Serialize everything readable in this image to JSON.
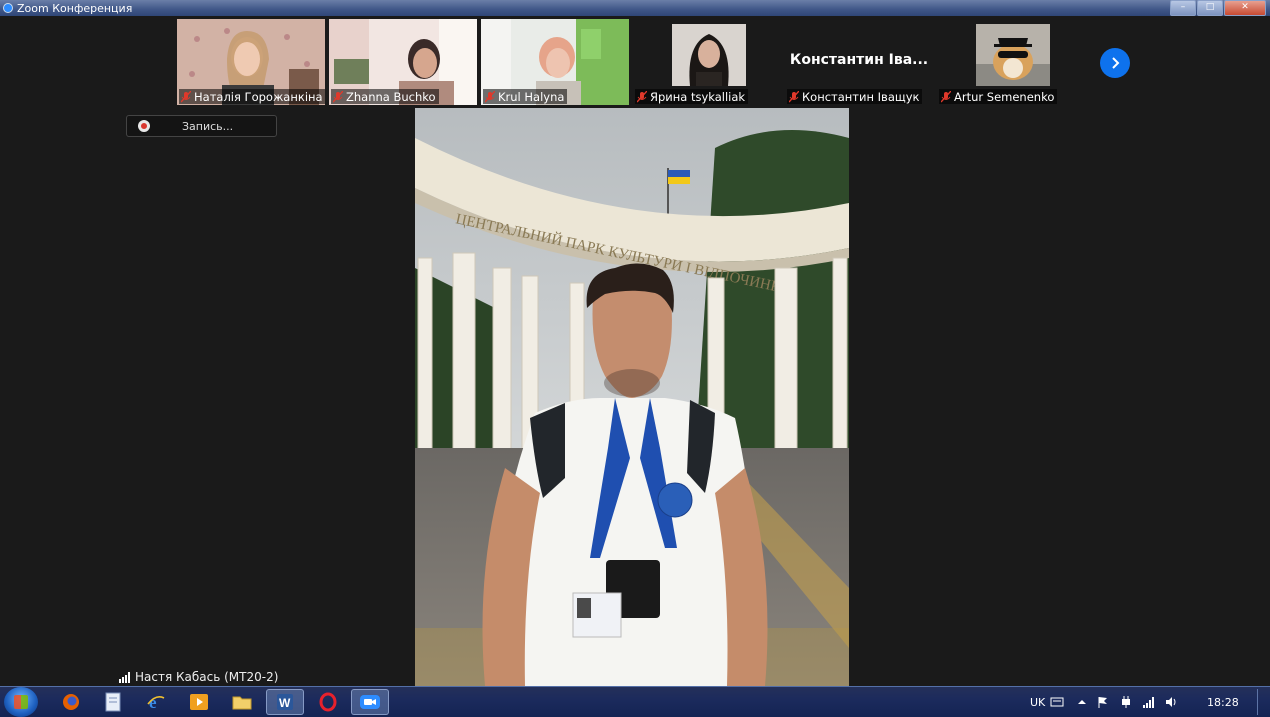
{
  "window": {
    "title": "Zoom Конференция",
    "controls": {
      "minimize": "–",
      "maximize": "□",
      "close": "✕"
    }
  },
  "participants": [
    {
      "name": "Наталія Горожанкіна",
      "muted": true,
      "video": true
    },
    {
      "name": "Zhanna Buchko",
      "muted": true,
      "video": true
    },
    {
      "name": "Krul Halyna",
      "muted": true,
      "video": true
    },
    {
      "name": "Ярина tsykalliak",
      "muted": true,
      "video": false,
      "avatar": "photo"
    },
    {
      "name": "Константин Іващук",
      "display_name": "Константин Іва...",
      "muted": true,
      "video": false
    },
    {
      "name": "Artur Semenenko",
      "muted": true,
      "video": false,
      "avatar": "dog-photo"
    }
  ],
  "recording": {
    "label": "Запись..."
  },
  "main_video": {
    "speaker_name": "Настя Кабась (МТ20-2)",
    "arch_text": "ЦЕНТРАЛЬНИЙ ПАРК КУЛЬТУРИ І ВІДПОЧИНКУ"
  },
  "taskbar": {
    "apps": [
      "firefox-icon",
      "document-icon",
      "internet-explorer-icon",
      "media-player-icon",
      "file-explorer-icon",
      "word-icon",
      "opera-icon",
      "zoom-icon"
    ],
    "active_apps": [
      "word-icon",
      "zoom-icon"
    ],
    "language": "UK",
    "clock": "18:28"
  },
  "colors": {
    "accent": "#0e72ed",
    "muted_mic": "#e0392b",
    "background": "#1a1a1a"
  }
}
